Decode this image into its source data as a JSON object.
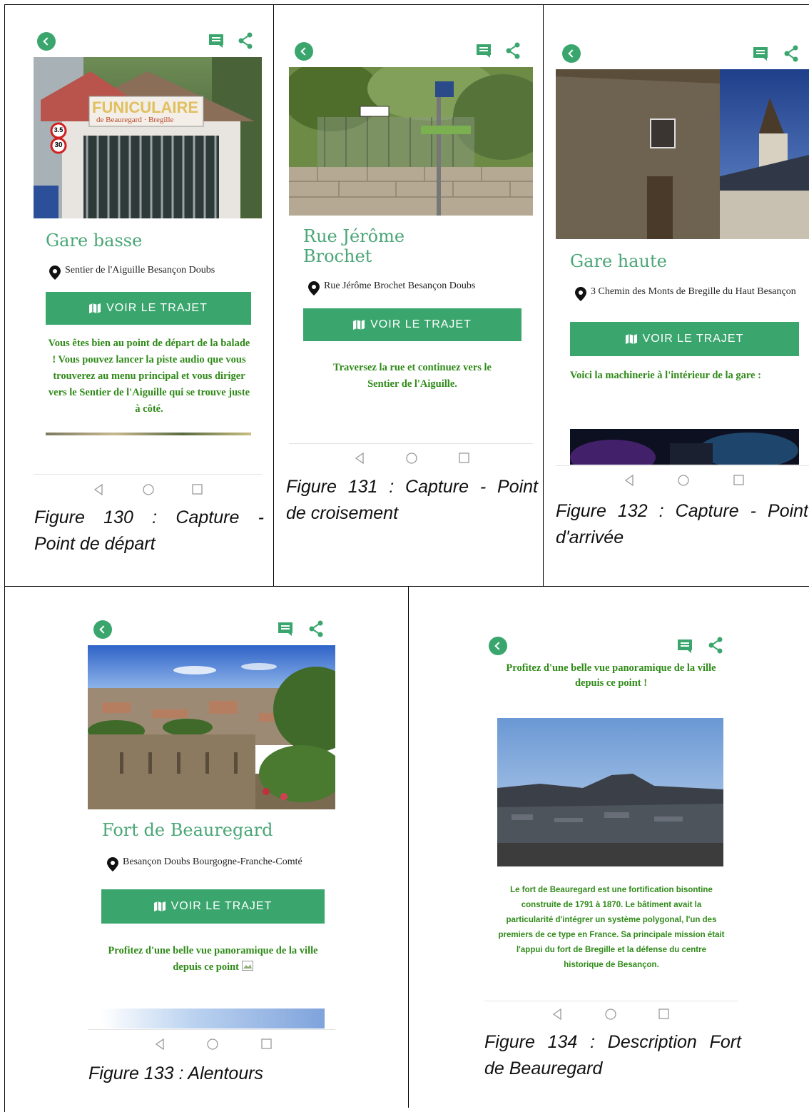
{
  "colors": {
    "accent": "#3aa66e",
    "title_green": "#4aa676",
    "text_green": "#2f8a18"
  },
  "icons": [
    "back-arrow-icon",
    "comment-icon",
    "share-icon",
    "location-pin-icon",
    "map-icon",
    "nav-back-icon",
    "nav-home-icon",
    "nav-recent-icon"
  ],
  "figures": [
    {
      "title": "Gare basse",
      "address": "Sentier de l'Aiguille Besançon Doubs",
      "button": "VOIR LE TRAJET",
      "description": "Vous êtes bien au point de départ de la balade ! Vous pouvez lancer la piste audio que vous trouverez au menu principal et vous diriger vers le Sentier de l'Aiguille qui se trouve juste à côté.",
      "caption_line1": "Figure 130 : Capture -",
      "caption_line2": "Point de départ",
      "sign_text": "FUNICULAIRE",
      "sign_sub": "de Beauregard · Bregille",
      "speed_1": "3.5",
      "speed_2": "30"
    },
    {
      "title_line1": "Rue Jérôme",
      "title_line2": "Brochet",
      "address": "Rue Jérôme Brochet Besançon Doubs",
      "button": "VOIR LE TRAJET",
      "description": "Traversez la rue et continuez vers le Sentier de l'Aiguille.",
      "caption_line1": "Figure 131 : Capture - Point",
      "caption_line2": "de croisement"
    },
    {
      "title": "Gare haute",
      "address": "3 Chemin des Monts de Bregille du Haut Besançon",
      "button": "VOIR LE TRAJET",
      "description": "Voici la machinerie à l'intérieur de la gare :",
      "caption_line1": "Figure 132 : Capture - Point",
      "caption_line2": "d'arrivée"
    },
    {
      "title": "Fort de Beauregard",
      "address": "Besançon Doubs Bourgogne-Franche-Comté",
      "button": "VOIR LE TRAJET",
      "description": "Profitez d'une belle vue panoramique de la ville depuis ce point",
      "caption": "Figure 133 : Alentours"
    },
    {
      "intro": "Profitez d'une belle vue panoramique de la ville depuis ce point !",
      "description": "Le fort de Beauregard est une fortification bisontine construite de 1791 à 1870. Le bâtiment avait la particularité d'intégrer un système polygonal, l'un des premiers de ce type en France. Sa principale mission était l'appui du fort de Bregille et la défense du centre historique de Besançon.",
      "caption_line1": "Figure 134 : Description Fort",
      "caption_line2": "de Beauregard"
    }
  ]
}
